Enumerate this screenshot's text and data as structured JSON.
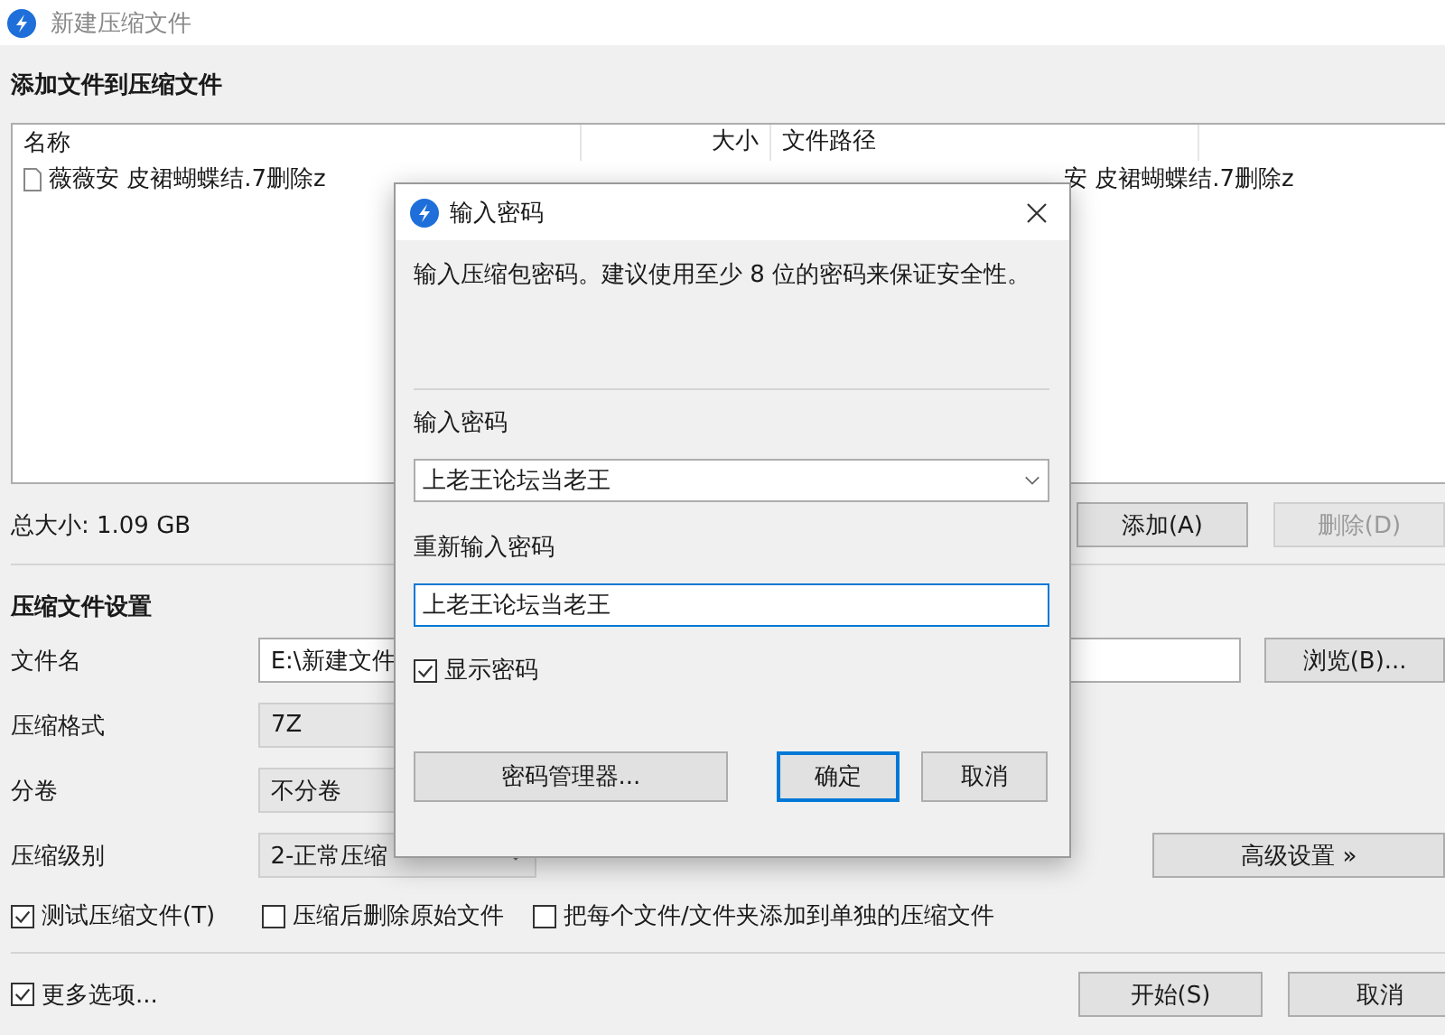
{
  "window": {
    "title": "新建压缩文件"
  },
  "files_section": {
    "heading": "添加文件到压缩文件",
    "columns": [
      "名称",
      "大小",
      "文件路径"
    ],
    "rows": [
      {
        "name": "薇薇安  皮裙蝴蝶结.7删除z",
        "path": "安  皮裙蝴蝶结.7删除z"
      }
    ],
    "total_size": "总大小: 1.09 GB",
    "buttons": [
      {
        "label": "添加(A)",
        "disabled": false
      },
      {
        "label": "删除(D)",
        "disabled": true
      }
    ]
  },
  "settings": {
    "heading": "压缩文件设置",
    "fields": [
      {
        "kind": "text",
        "label": "文件名",
        "value": "E:\\新建文件",
        "button": "浏览(B)..."
      },
      {
        "kind": "readonly",
        "label": "压缩格式",
        "value": "7Z"
      },
      {
        "kind": "readonly",
        "label": "分卷",
        "value": "不分卷"
      },
      {
        "kind": "dropdown",
        "label": "压缩级别",
        "value": "2-正常压缩",
        "button": "高级设置 »"
      }
    ],
    "options": [
      {
        "label": "测试压缩文件(T)",
        "checked": true
      },
      {
        "label": "压缩后删除原始文件",
        "checked": false
      },
      {
        "label": "把每个文件/文件夹添加到单独的压缩文件",
        "checked": false
      }
    ]
  },
  "footer": {
    "more_options": {
      "label": "更多选项...",
      "checked": true
    },
    "buttons": [
      "开始(S)",
      "取消"
    ]
  },
  "dialog": {
    "title": "输入密码",
    "message": "输入压缩包密码。建议使用至少 8 位的密码来保证安全性。",
    "password_label": "输入密码",
    "password": "上老王论坛当老王",
    "confirm_label": "重新输入密码",
    "confirm": "上老王论坛当老王",
    "show_password": {
      "label": "显示密码",
      "checked": true
    },
    "buttons": [
      {
        "label": "密码管理器...",
        "default": false
      },
      {
        "label": "确定",
        "default": true
      },
      {
        "label": "取消",
        "default": false
      }
    ]
  }
}
